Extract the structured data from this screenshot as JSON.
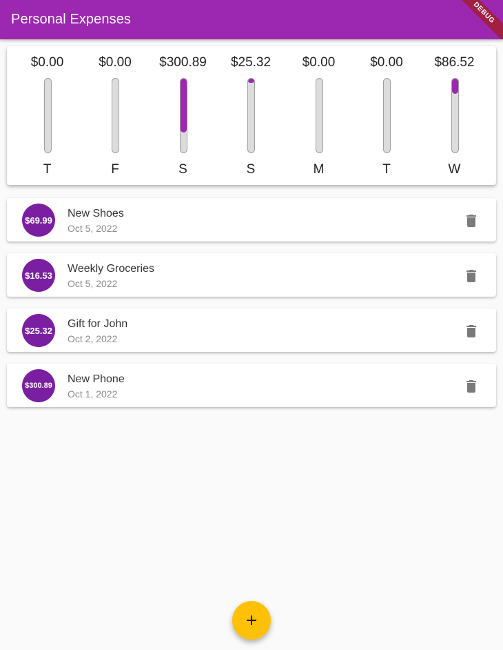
{
  "app_bar": {
    "title": "Personal Expenses",
    "debug_label": "DEBUG"
  },
  "colors": {
    "primary": "#9c27b0",
    "avatar": "#7b1fa2",
    "accent": "#ffc107",
    "track": "#dcdcdc"
  },
  "chart_data": {
    "type": "bar",
    "categories": [
      "T",
      "F",
      "S",
      "S",
      "M",
      "T",
      "W"
    ],
    "value_labels": [
      "$0.00",
      "$0.00",
      "$300.89",
      "$25.32",
      "$0.00",
      "$0.00",
      "$86.52"
    ],
    "values": [
      0,
      0,
      300.89,
      25.32,
      0,
      0,
      86.52
    ],
    "fraction_of_week_total": [
      0,
      0,
      0.73,
      0.06,
      0,
      0,
      0.21
    ]
  },
  "transactions": [
    {
      "amount": "$69.99",
      "title": "New Shoes",
      "date": "Oct 5, 2022",
      "delete_icon": "trash-icon"
    },
    {
      "amount": "$16.53",
      "title": "Weekly Groceries",
      "date": "Oct 5, 2022",
      "delete_icon": "trash-icon"
    },
    {
      "amount": "$25.32",
      "title": "Gift for John",
      "date": "Oct 2, 2022",
      "delete_icon": "trash-icon"
    },
    {
      "amount": "$300.89",
      "title": "New Phone",
      "date": "Oct 1, 2022",
      "delete_icon": "trash-icon"
    }
  ],
  "fab": {
    "icon": "add-icon"
  }
}
